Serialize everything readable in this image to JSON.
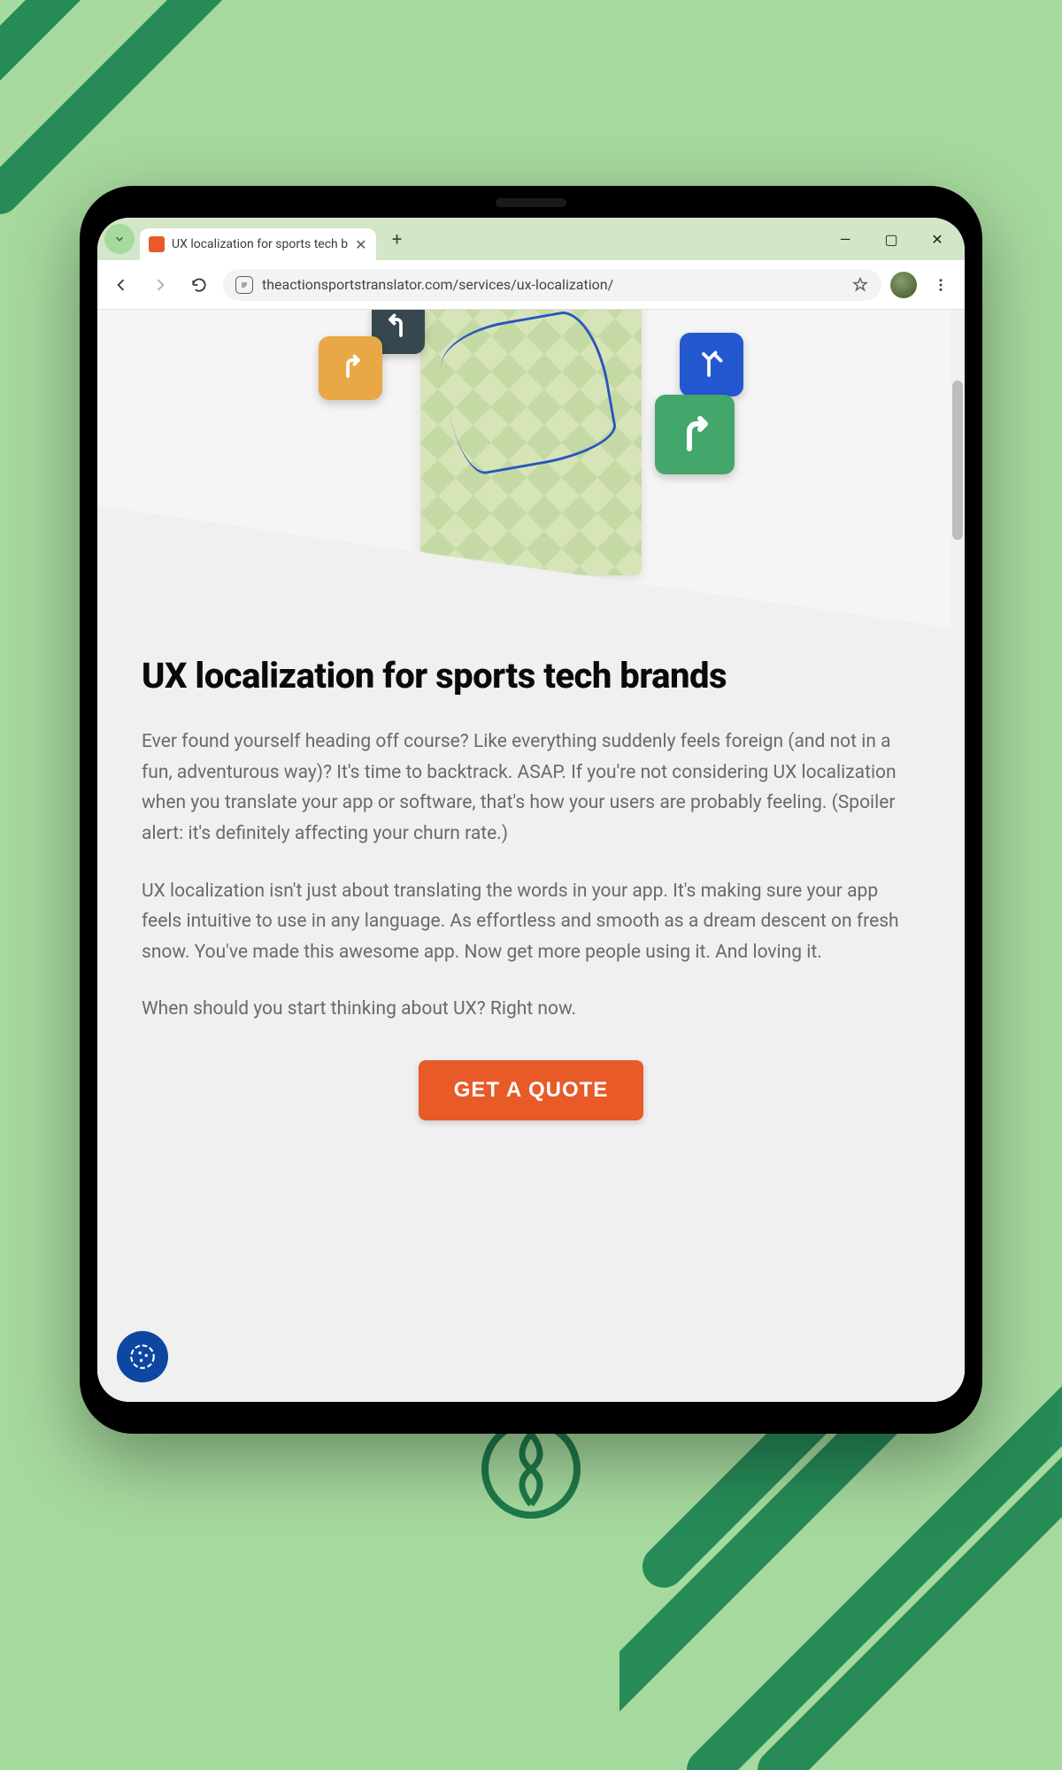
{
  "browser": {
    "tab_title": "UX localization for sports tech b",
    "new_tab_label": "+",
    "window_minimize": "—",
    "window_restore": "▢",
    "window_close": "✕",
    "url": "theactionsportstranslator.com/services/ux-localization/"
  },
  "hero": {
    "tile_yellow_name": "turn-right",
    "tile_dark_name": "turn-left",
    "tile_blue_name": "fork-right",
    "tile_green_name": "turn-right"
  },
  "content": {
    "heading": "UX localization for sports tech brands",
    "p1": "Ever found yourself heading off course? Like everything suddenly feels foreign (and not in a fun, adventurous way)? It's time to backtrack. ASAP. If you're not considering UX localization when you translate your app or software, that's how your users are probably feeling. (Spoiler alert: it's definitely affecting your churn rate.)",
    "p2": "UX localization isn't just about translating the words in your app. It's making sure your app feels intuitive to use in any language. As effortless and smooth as a dream descent on fresh snow. You've made this awesome app. Now get more people using it. And loving it.",
    "p3": "When should you start thinking about UX? Right now.",
    "cta": "GET A QUOTE"
  },
  "colors": {
    "bg": "#a6d99e",
    "accent_green": "#268b57",
    "cta": "#e85a28",
    "badge": "#0d47a1"
  }
}
